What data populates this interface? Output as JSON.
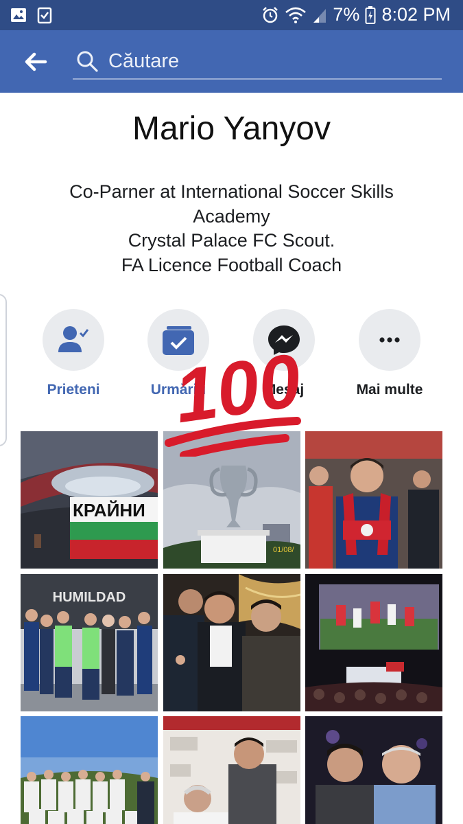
{
  "status_bar": {
    "battery": "7%",
    "time": "8:02 PM"
  },
  "search": {
    "placeholder": "Căutare"
  },
  "profile": {
    "name": "Mario Yanyov",
    "bio_lines": [
      "Co-Parner at International Soccer Skills",
      "Academy",
      "Crystal Palace FC Scout.",
      "FA Licence Football Coach"
    ]
  },
  "actions": [
    {
      "label": "Prieteni",
      "icon": "friends-check-icon"
    },
    {
      "label": "Urmăriți",
      "icon": "following-check-icon"
    },
    {
      "label": "Mesaj",
      "icon": "messenger-icon"
    },
    {
      "label": "Mai multe",
      "icon": "more-dots-icon"
    }
  ],
  "overlay": {
    "sticker_text": "100"
  },
  "photos": {
    "p2_date": "01/08/"
  },
  "colors": {
    "status_bar": "#2f4c86",
    "app_bar": "#4267b2",
    "accent": "#4267b2",
    "sticker_red": "#d81b2b"
  }
}
